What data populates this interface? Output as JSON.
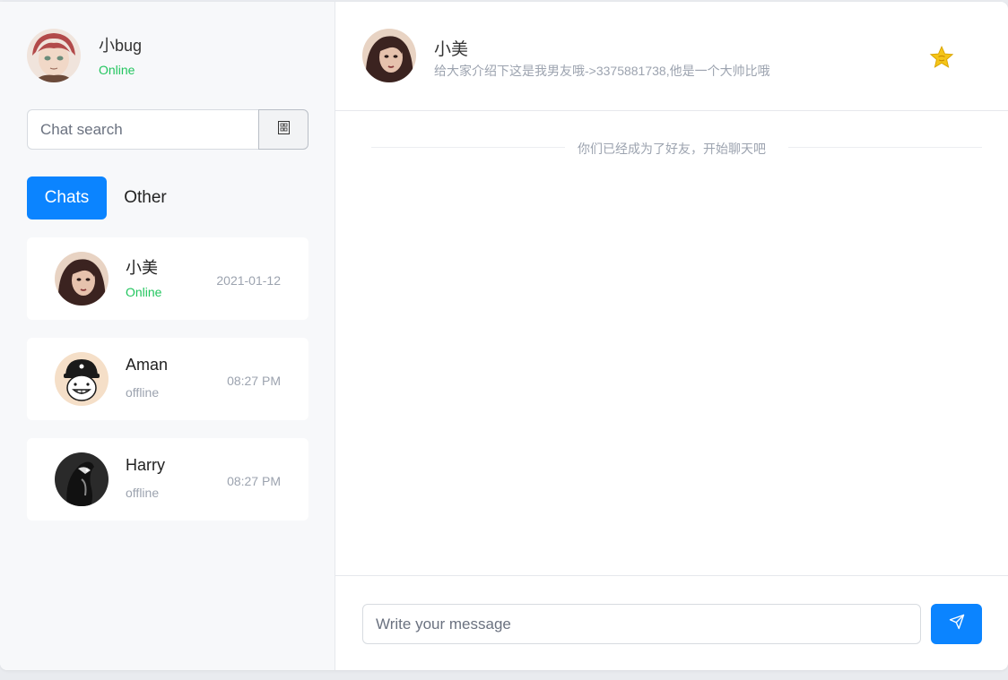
{
  "colors": {
    "accent": "#0b84ff",
    "online": "#22c55e",
    "offline": "#9ca3af",
    "star": "#f5c518"
  },
  "profile": {
    "name": "小bug",
    "status": "Online",
    "avatar_icon": "user-avatar-icon"
  },
  "search": {
    "placeholder": "Chat search",
    "button_icon": "search-icon"
  },
  "tabs": [
    {
      "label": "Chats",
      "active": true
    },
    {
      "label": "Other",
      "active": false
    }
  ],
  "chats": [
    {
      "name": "小美",
      "status": "Online",
      "time": "2021-01-12",
      "online": true
    },
    {
      "name": "Aman",
      "status": "offline",
      "time": "08:27 PM",
      "online": false
    },
    {
      "name": "Harry",
      "status": "offline",
      "time": "08:27 PM",
      "online": false
    }
  ],
  "conversation": {
    "name": "小美",
    "subtitle": "给大家介绍下这是我男友哦->3375881738,他是一个大帅比哦",
    "favorite_icon": "star-icon",
    "system_message": "你们已经成为了好友，开始聊天吧"
  },
  "composer": {
    "placeholder": "Write your message",
    "send_icon": "send-icon"
  }
}
